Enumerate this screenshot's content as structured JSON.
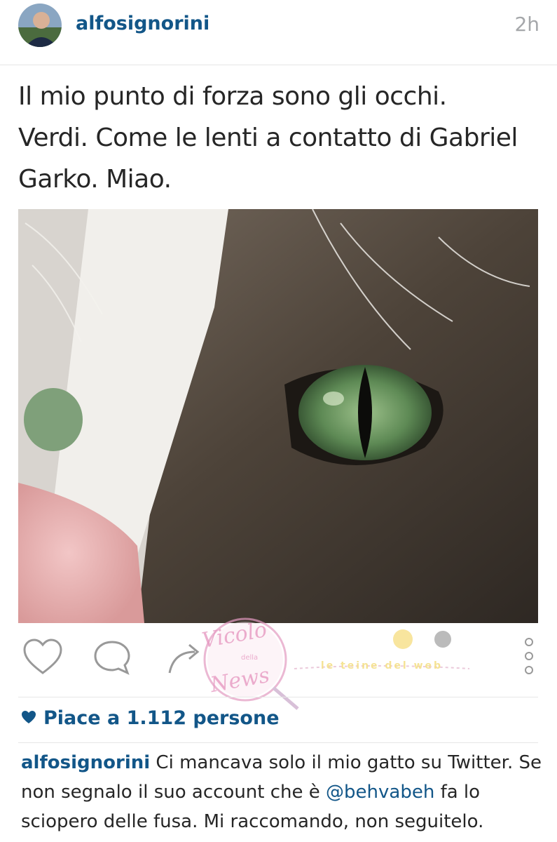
{
  "post": {
    "username": "alfosignorini",
    "time": "2h",
    "text_lines": [
      "Il mio punto di forza sono gli occhi.",
      "Verdi. Come le lenti a contatto di Gabriel",
      "Garko. Miao."
    ]
  },
  "actions": {
    "like_icon": "heart-outline-icon",
    "comment_icon": "comment-bubble-icon",
    "share_icon": "share-arrow-icon",
    "more_icon": "more-vertical-icon"
  },
  "likes": {
    "label": "Piace a 1.112 persone"
  },
  "caption": {
    "username": "alfosignorini",
    "text_part1": " Ci mancava solo il mio gatto su Twitter. Se non segnalo il suo account che è ",
    "mention": "@behvabeh",
    "text_part2": " fa lo sciopero delle fusa. Mi raccomando, non seguitelo."
  },
  "watermark": {
    "circle_text_1": "Vicolo",
    "circle_text_2": "della",
    "circle_text_3": "News",
    "banner_text": "le teine del web"
  },
  "colors": {
    "link_blue": "#125688",
    "time_gray": "#a5a7aa",
    "icon_gray": "#999999"
  }
}
